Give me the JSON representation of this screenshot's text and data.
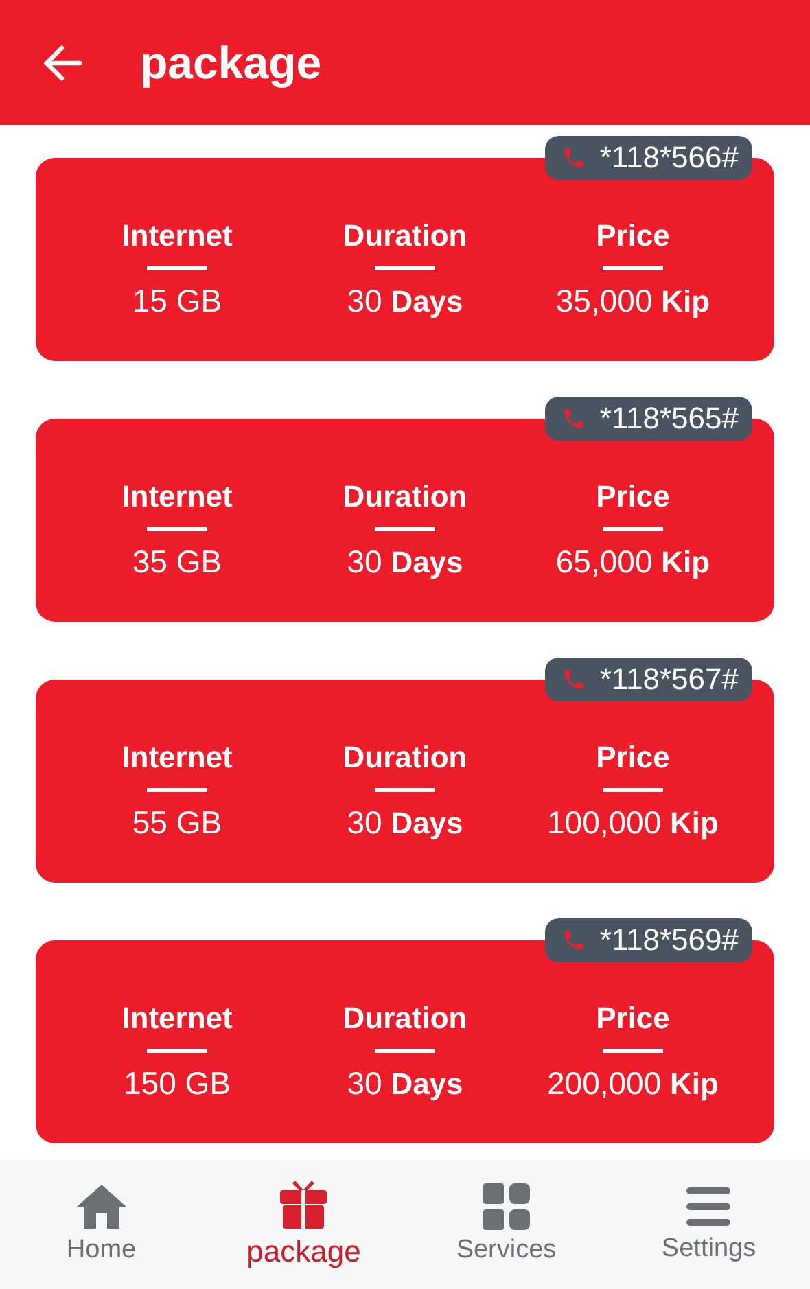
{
  "header": {
    "title": "package"
  },
  "packages": [
    {
      "code": "*118*566#",
      "columns": [
        {
          "label": "Internet",
          "value": "15 GB"
        },
        {
          "label": "Duration",
          "value": "30 **Days**"
        },
        {
          "label": "Price",
          "value": "35,000 **Kip**"
        }
      ]
    },
    {
      "code": "*118*565#",
      "columns": [
        {
          "label": "Internet",
          "value": "35 GB"
        },
        {
          "label": "Duration",
          "value": "30 **Days**"
        },
        {
          "label": "Price",
          "value": "65,000 **Kip**"
        }
      ]
    },
    {
      "code": "*118*567#",
      "columns": [
        {
          "label": "Internet",
          "value": "55 GB"
        },
        {
          "label": "Duration",
          "value": "30 **Days**"
        },
        {
          "label": "Price",
          "value": "100,000 **Kip**"
        }
      ]
    },
    {
      "code": "*118*569#",
      "columns": [
        {
          "label": "Internet",
          "value": "150 GB"
        },
        {
          "label": "Duration",
          "value": "30 **Days**"
        },
        {
          "label": "Price",
          "value": "200,000 **Kip**"
        }
      ]
    }
  ],
  "nav": [
    {
      "kind": "home",
      "label": "Home",
      "selected": false
    },
    {
      "kind": "package",
      "label": "package",
      "selected": true
    },
    {
      "kind": "services",
      "label": "Services",
      "selected": false
    },
    {
      "kind": "settings",
      "label": "Settings",
      "selected": false
    }
  ]
}
